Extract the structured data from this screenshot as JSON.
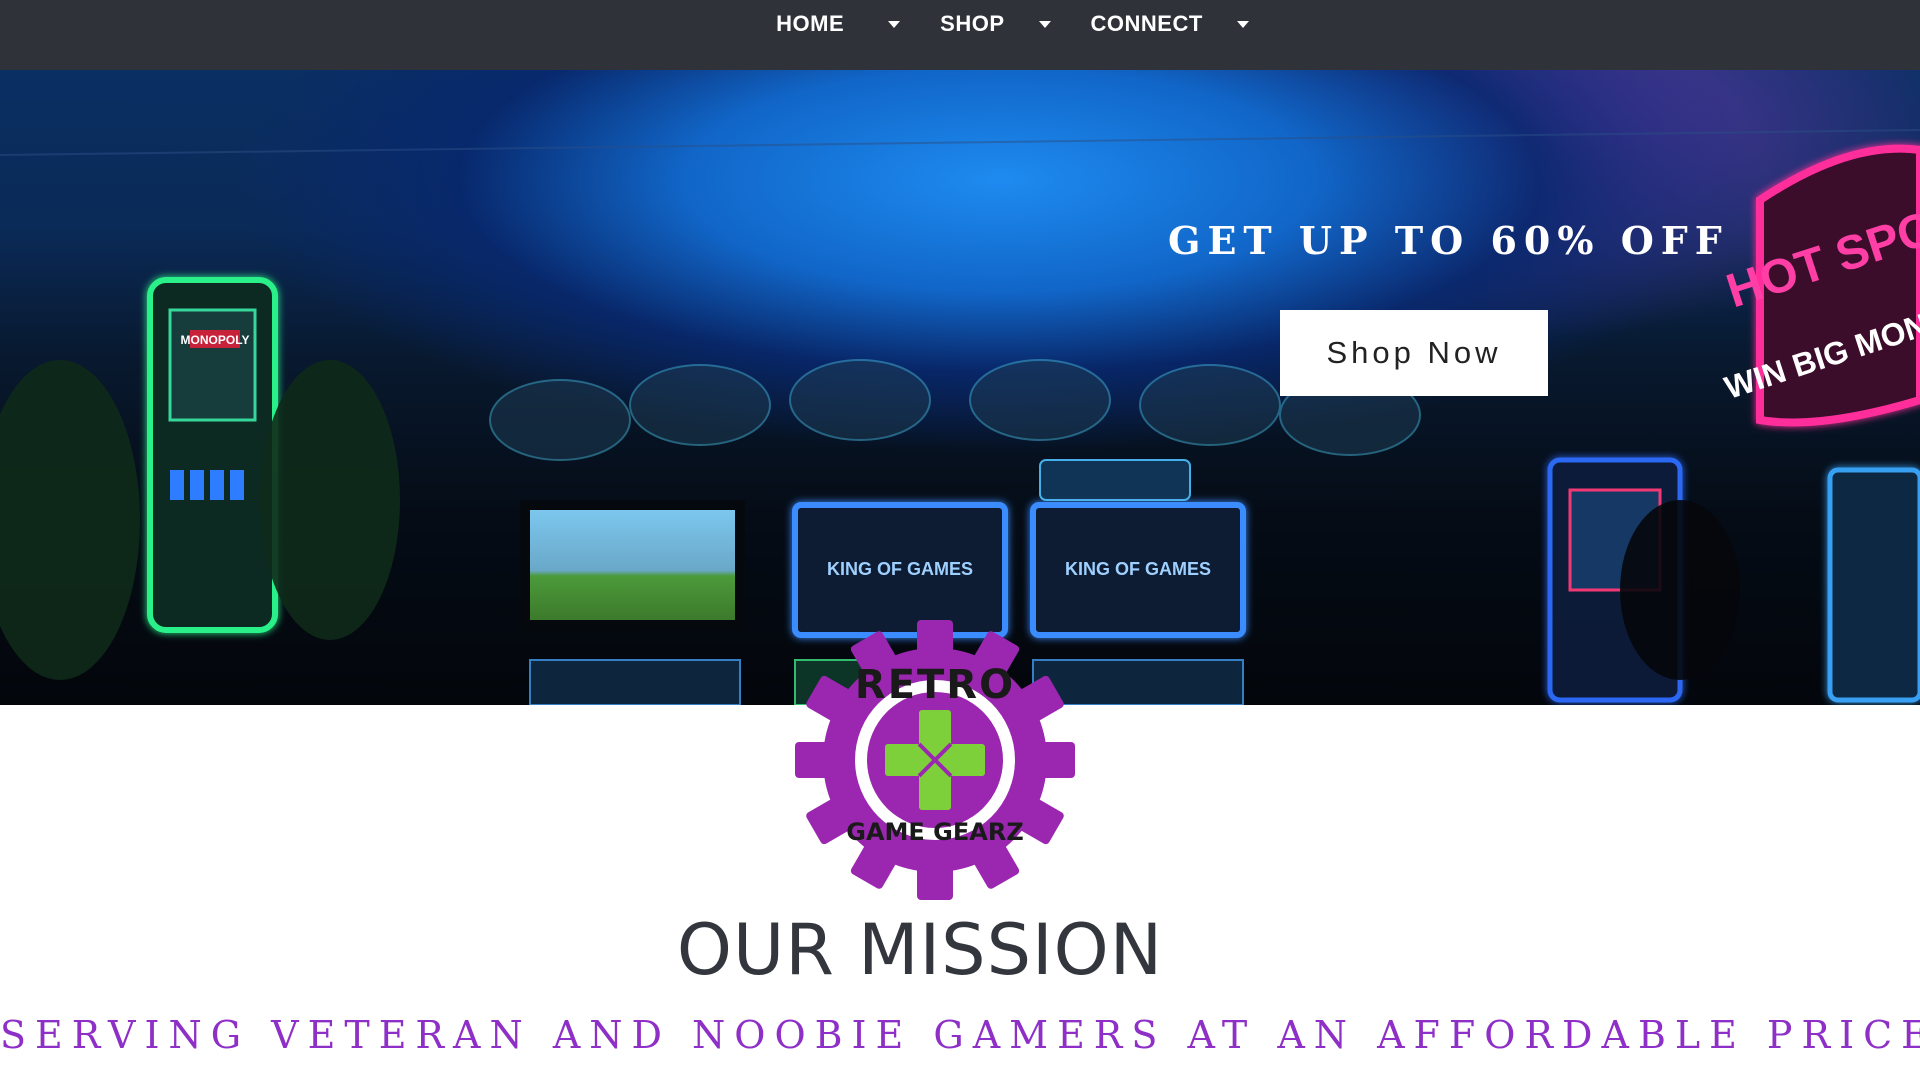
{
  "nav": {
    "items": [
      {
        "label": "HOME"
      },
      {
        "label": "SHOP"
      },
      {
        "label": "CONNECT"
      }
    ]
  },
  "hero": {
    "promo_text": "GET UP TO 60% OFF",
    "cta_label": "Shop Now",
    "screen_text": "KING OF GAMES",
    "left_machine_text": "MONOPOLY",
    "right_sign_text": "HOT SPOT",
    "right_sign_sub": "WIN BIG MONEY"
  },
  "logo": {
    "top_text": "RETRO",
    "bottom_text": "GAME GEARZ",
    "gear_color": "#9b27b0",
    "cross_color": "#7ed03a"
  },
  "mission": {
    "title": "OUR MISSION",
    "subtitle": "SERVING VETERAN AND NOOBIE GAMERS AT AN AFFORDABLE PRICE."
  },
  "colors": {
    "nav_bg": "#2f3339",
    "accent_purple": "#8e2fc7",
    "title_gray": "#33373d"
  }
}
